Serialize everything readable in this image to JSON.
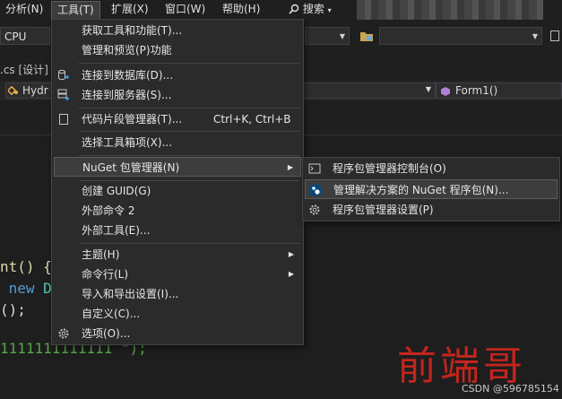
{
  "menubar": {
    "items": [
      {
        "label": "分析(N)"
      },
      {
        "label": "工具(T)"
      },
      {
        "label": "扩展(X)"
      },
      {
        "label": "窗口(W)"
      },
      {
        "label": "帮助(H)"
      }
    ],
    "search_label": "搜索"
  },
  "toolbar": {
    "platform_value": "CPU"
  },
  "editor": {
    "tab_label": ".cs [设计]",
    "nav_left": "Hydr",
    "nav_right": "Form1()",
    "code_line1": "nt() {",
    "code_line2a": " new",
    "code_line2b": " D",
    "code_line3": "();",
    "code_line4": "1111111111111 \");"
  },
  "tools_menu": {
    "items": [
      {
        "label": "获取工具和功能(T)..."
      },
      {
        "label": "管理和预览(P)功能"
      },
      {
        "label": "连接到数据库(D)..."
      },
      {
        "label": "连接到服务器(S)..."
      },
      {
        "label": "代码片段管理器(T)...",
        "shortcut": "Ctrl+K, Ctrl+B"
      },
      {
        "label": "选择工具箱项(X)..."
      },
      {
        "label": "NuGet 包管理器(N)"
      },
      {
        "label": "创建 GUID(G)"
      },
      {
        "label": "外部命令 2"
      },
      {
        "label": "外部工具(E)..."
      },
      {
        "label": "主题(H)"
      },
      {
        "label": "命令行(L)"
      },
      {
        "label": "导入和导出设置(I)..."
      },
      {
        "label": "自定义(C)..."
      },
      {
        "label": "选项(O)..."
      }
    ]
  },
  "nuget_submenu": {
    "items": [
      {
        "label": "程序包管理器控制台(O)"
      },
      {
        "label": "管理解决方案的 NuGet 程序包(N)..."
      },
      {
        "label": "程序包管理器设置(P)"
      }
    ]
  },
  "watermark": "前端哥",
  "credit": "CSDN @596785154"
}
